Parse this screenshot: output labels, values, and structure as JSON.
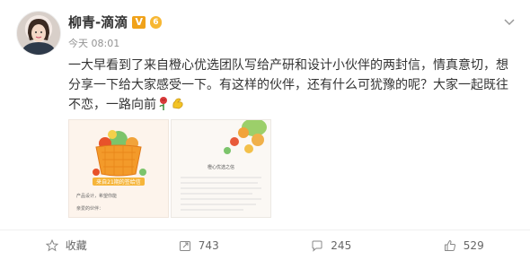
{
  "post": {
    "author_name": "柳青-滴滴",
    "vip_badge": "V",
    "level_badge": "6",
    "time": "今天 08:01",
    "text_main": "一大早看到了来自橙心优选团队写给产研和设计小伙伴的两封信，情真意切，想分享一下给大家感受一下。有这样的伙伴，还有什么可犹豫的呢？大家一起既往不恋，一路向前",
    "emojis": [
      "rose-icon",
      "flexed-biceps-icon"
    ]
  },
  "images": {
    "left": {
      "banner_text": "来自21期的签给信",
      "line1": "产品设计，希望你能",
      "line2": "亲爱的伙伴："
    },
    "right": {
      "title": "橙心优选之信"
    }
  },
  "actions": [
    {
      "icon": "star-icon",
      "label": "收藏"
    },
    {
      "icon": "share-icon",
      "label": "743"
    },
    {
      "icon": "comment-icon",
      "label": "245"
    },
    {
      "icon": "thumbs-up-icon",
      "label": "529"
    }
  ],
  "colors": {
    "text": "#333333",
    "muted": "#939393",
    "badge_gold": "#f0a21a"
  }
}
